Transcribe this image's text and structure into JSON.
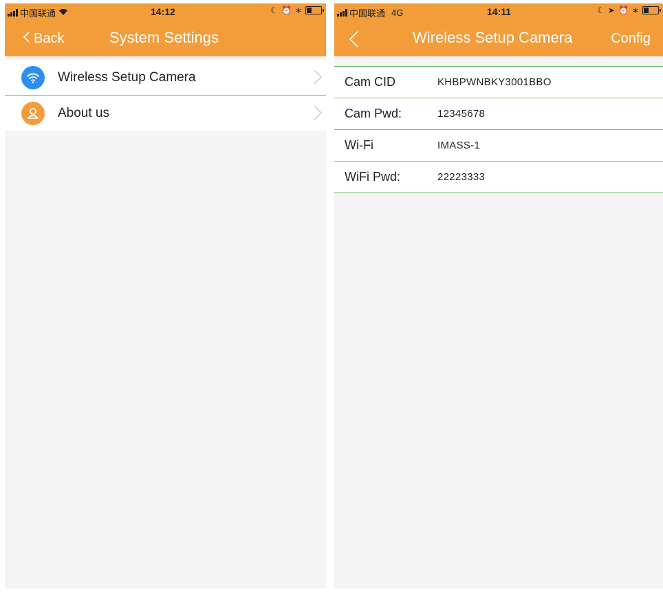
{
  "left_screen": {
    "status": {
      "carrier": "中国联通",
      "time": "14:12"
    },
    "nav": {
      "back_label": "Back",
      "title": "System Settings"
    },
    "menu": [
      {
        "label": "Wireless Setup Camera",
        "icon": "wifi-icon",
        "icon_color": "#2e8ef0"
      },
      {
        "label": "About us",
        "icon": "person-icon",
        "icon_color": "#f39c3a"
      }
    ]
  },
  "right_screen": {
    "status": {
      "carrier": "中国联通",
      "network": "4G",
      "time": "14:11"
    },
    "nav": {
      "title": "Wireless Setup Camera",
      "action_label": "Config"
    },
    "fields": [
      {
        "label": "Cam CID",
        "value": "KHBPWNBKY3001BBO"
      },
      {
        "label": "Cam Pwd:",
        "value": "12345678"
      },
      {
        "label": "Wi-Fi",
        "value": "IMASS-1"
      },
      {
        "label": "WiFi Pwd:",
        "value": "22223333"
      }
    ]
  },
  "colors": {
    "nav_bar": "#f39c3a",
    "divider": "#7cbf6e",
    "background": "#f4f4f4"
  }
}
